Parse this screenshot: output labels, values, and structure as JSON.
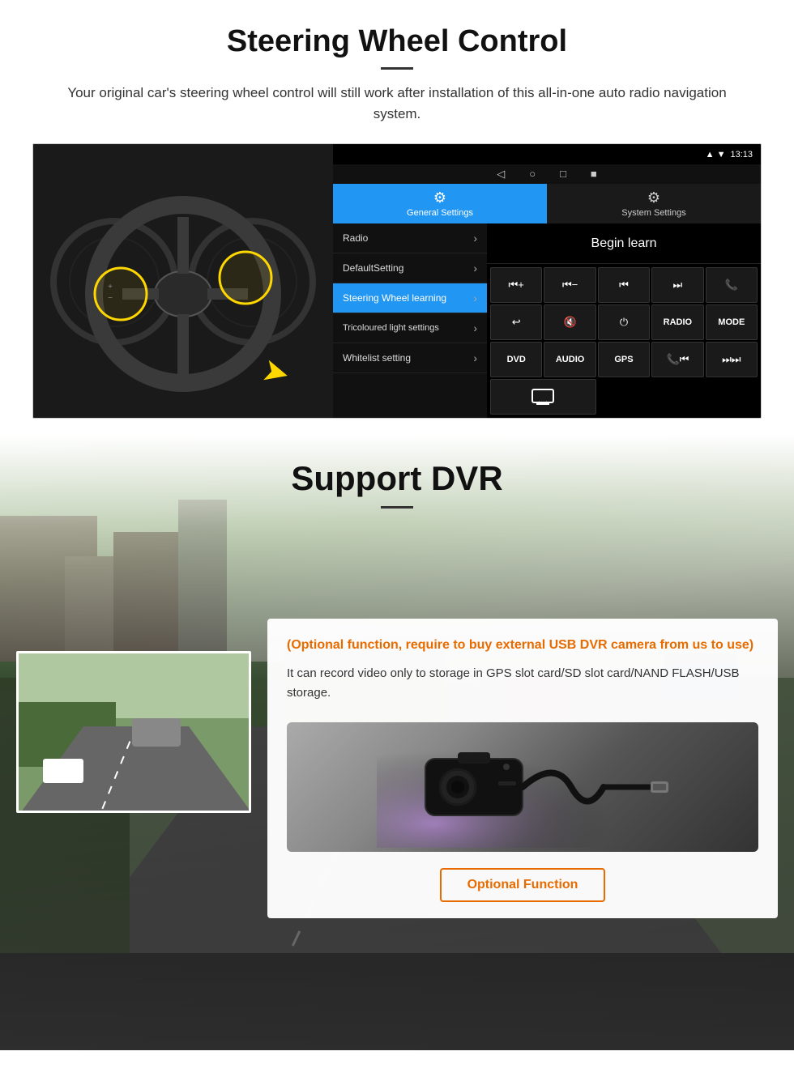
{
  "steering": {
    "title": "Steering Wheel Control",
    "subtitle": "Your original car's steering wheel control will still work after installation of this all-in-one auto radio navigation system.",
    "android": {
      "status_time": "13:13",
      "nav_buttons": [
        "◁",
        "○",
        "□",
        "■"
      ],
      "tabs": [
        {
          "icon": "⚙",
          "label": "General Settings",
          "active": true
        },
        {
          "icon": "⚙",
          "label": "System Settings",
          "active": false
        }
      ],
      "menu_items": [
        {
          "label": "Radio",
          "active": false
        },
        {
          "label": "DefaultSetting",
          "active": false
        },
        {
          "label": "Steering Wheel learning",
          "active": true
        },
        {
          "label": "Tricoloured light settings",
          "active": false
        },
        {
          "label": "Whitelist setting",
          "active": false
        }
      ],
      "begin_learn": "Begin learn",
      "control_buttons": [
        "⏮+",
        "⏮-",
        "⏮⏮",
        "⏭⏭",
        "📞",
        "↩",
        "🔇×",
        "⏻",
        "RADIO",
        "MODE",
        "DVD",
        "AUDIO",
        "GPS",
        "📞⏮⏭",
        "⏮⏭"
      ]
    }
  },
  "dvr": {
    "title": "Support DVR",
    "optional_note": "(Optional function, require to buy external USB DVR camera from us to use)",
    "description": "It can record video only to storage in GPS slot card/SD slot card/NAND FLASH/USB storage.",
    "optional_function_btn": "Optional Function"
  }
}
